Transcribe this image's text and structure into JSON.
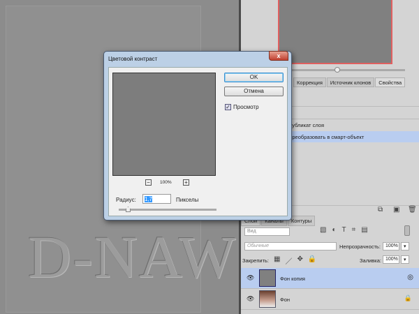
{
  "canvas": {
    "watermark": "D-NAW"
  },
  "panel": {
    "tabs": [
      "Коррекция",
      "Источник клонов",
      "Свойства"
    ],
    "history": [
      {
        "label": "Дубликат слоя",
        "selected": false
      },
      {
        "label": "Преобразовать в смарт-объект",
        "selected": true
      }
    ],
    "layers_tabs": [
      "Слои",
      "Каналы",
      "Контуры"
    ],
    "filter_label": "Вид",
    "blend_mode": "Обычные",
    "opacity_label": "Непрозрачность:",
    "opacity_value": "100%",
    "lock_label": "Закрепить:",
    "fill_label": "Заливка:",
    "fill_value": "100%",
    "layers": [
      {
        "name": "Фон копия",
        "selected": true
      },
      {
        "name": "Фон",
        "selected": false
      }
    ]
  },
  "dialog": {
    "title": "Цветовой контраст",
    "close": "x",
    "ok": "OK",
    "cancel": "Отмена",
    "preview_label": "Просмотр",
    "preview_checked": true,
    "zoom": "100%",
    "zoom_out": "−",
    "zoom_in": "+",
    "radius_label": "Радиус:",
    "radius_value": "1,7",
    "units": "Пикселы"
  }
}
